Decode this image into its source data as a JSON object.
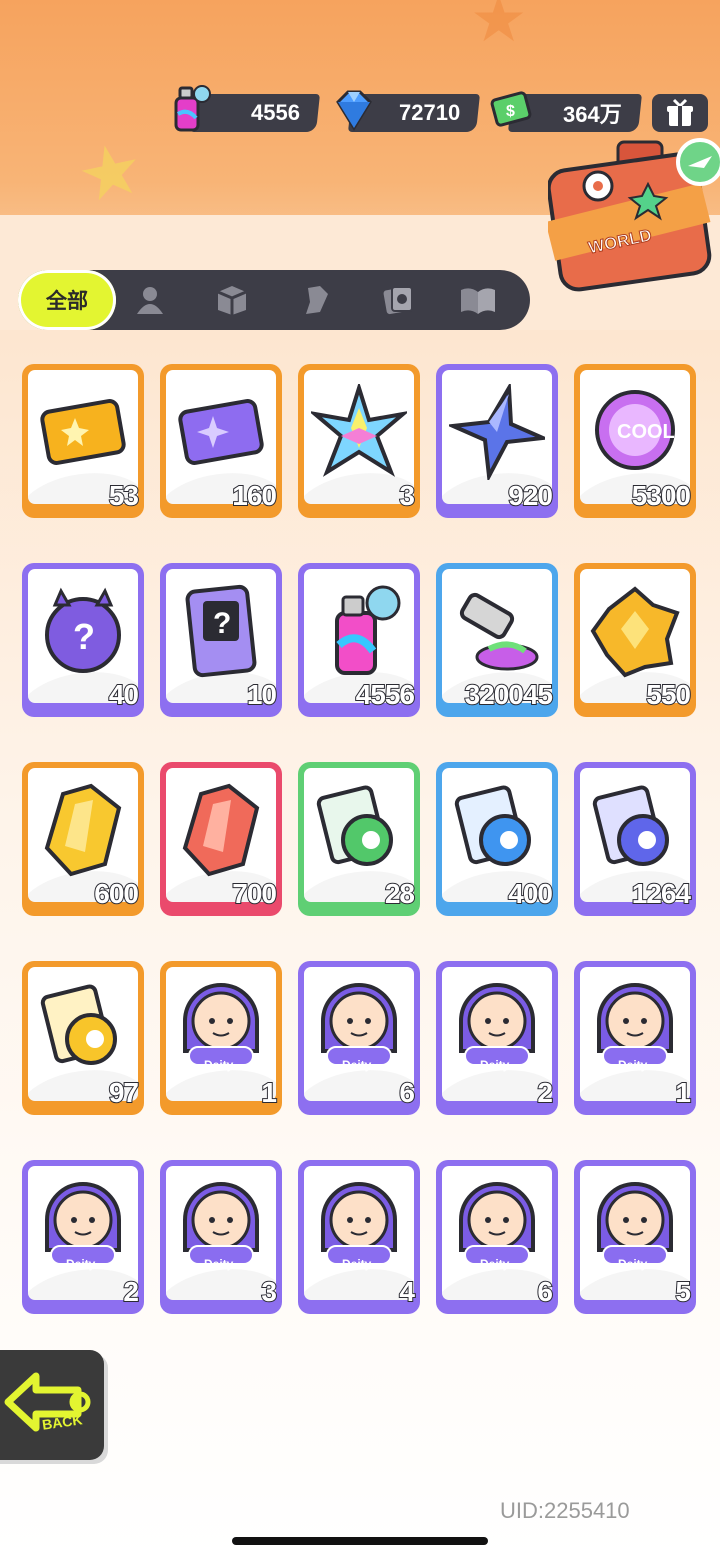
{
  "currencies": [
    {
      "name": "spray-can",
      "value": "4556"
    },
    {
      "name": "diamond",
      "value": "72710"
    },
    {
      "name": "cash",
      "value": "364万"
    }
  ],
  "gift_icon": "gift-box-icon",
  "world_badge": {
    "label": "WORLD"
  },
  "tabs": {
    "all_label": "全部",
    "icons": [
      "person-icon",
      "box-icon",
      "shirt-icon",
      "card-icon",
      "book-icon"
    ]
  },
  "items": [
    {
      "kind": "ticket-gold",
      "count": "53",
      "border": "orange"
    },
    {
      "kind": "ticket-purple",
      "count": "160",
      "border": "orange"
    },
    {
      "kind": "rainbow-star",
      "count": "3",
      "border": "orange"
    },
    {
      "kind": "blue-star",
      "count": "920",
      "border": "purple"
    },
    {
      "kind": "cool-badge",
      "count": "5300",
      "border": "orange"
    },
    {
      "kind": "mystery-egg",
      "count": "40",
      "border": "purple"
    },
    {
      "kind": "travel-card",
      "count": "10",
      "border": "purple"
    },
    {
      "kind": "spray-can",
      "count": "4556",
      "border": "purple"
    },
    {
      "kind": "paint-tube",
      "count": "320045",
      "border": "blue"
    },
    {
      "kind": "gold-gem",
      "count": "550",
      "border": "orange"
    },
    {
      "kind": "yellow-crystal",
      "count": "600",
      "border": "orange"
    },
    {
      "kind": "red-crystal",
      "count": "700",
      "border": "red"
    },
    {
      "kind": "film-green",
      "count": "28",
      "border": "green"
    },
    {
      "kind": "film-blue",
      "count": "400",
      "border": "blue"
    },
    {
      "kind": "film-purple",
      "count": "1264",
      "border": "purple"
    },
    {
      "kind": "film-gold",
      "count": "97",
      "border": "orange"
    },
    {
      "kind": "deity-avatar",
      "count": "1",
      "border": "orange",
      "label": "Deity"
    },
    {
      "kind": "deity-avatar",
      "count": "6",
      "border": "purple",
      "label": "Deity"
    },
    {
      "kind": "deity-avatar",
      "count": "2",
      "border": "purple",
      "label": "Deity"
    },
    {
      "kind": "deity-avatar",
      "count": "1",
      "border": "purple",
      "label": "Deity"
    },
    {
      "kind": "deity-avatar",
      "count": "2",
      "border": "purple",
      "label": "Deity"
    },
    {
      "kind": "deity-avatar",
      "count": "3",
      "border": "purple",
      "label": "Deity"
    },
    {
      "kind": "deity-avatar",
      "count": "4",
      "border": "purple",
      "label": "Deity"
    },
    {
      "kind": "deity-avatar",
      "count": "6",
      "border": "purple",
      "label": "Deity"
    },
    {
      "kind": "deity-avatar",
      "count": "5",
      "border": "purple",
      "label": "Deity"
    }
  ],
  "back_label": "BACK",
  "uid": "UID:2255410"
}
